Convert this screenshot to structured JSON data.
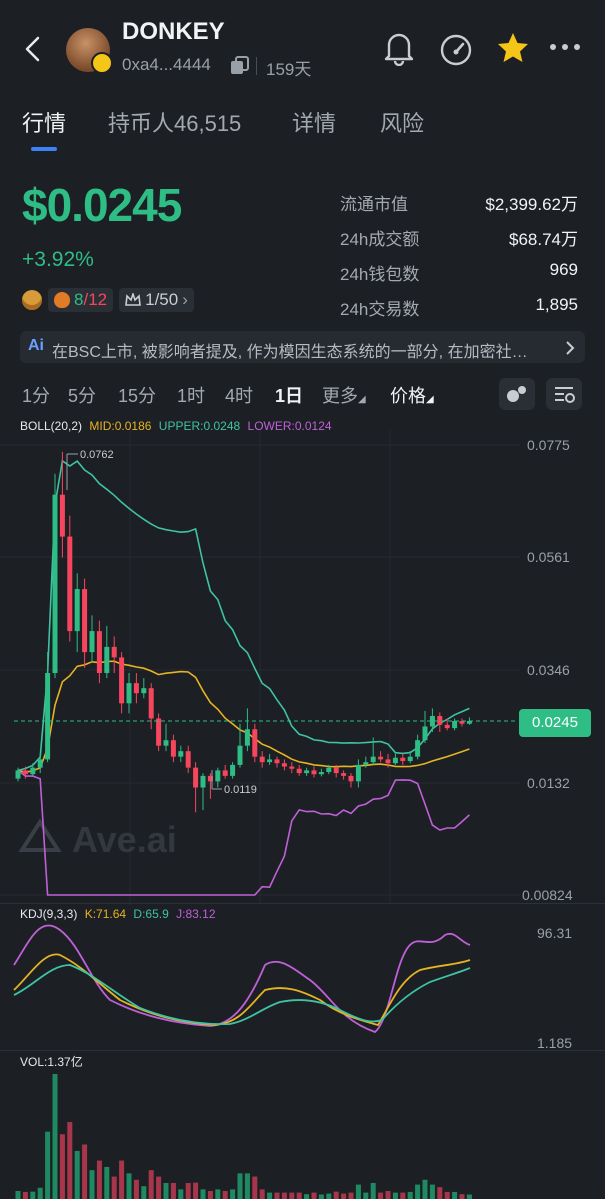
{
  "header": {
    "title": "DONKEY",
    "address": "0xa4...4444",
    "age": "159天"
  },
  "tabs": [
    {
      "label": "行情"
    },
    {
      "label": "持币人46,515"
    },
    {
      "label": "详情"
    },
    {
      "label": "风险"
    }
  ],
  "price": {
    "value": "$0.0245",
    "change": "+3.92%"
  },
  "badges": {
    "holders_ratio_a": "8",
    "holders_ratio_b": "/12",
    "rank": "1/50"
  },
  "stats": [
    {
      "label": "流通市值",
      "value": "$2,399.62万"
    },
    {
      "label": "24h成交额",
      "value": "$68.74万"
    },
    {
      "label": "24h钱包数",
      "value": "969"
    },
    {
      "label": "24h交易数",
      "value": "1,895"
    }
  ],
  "ai_summary": {
    "icon": "Ai",
    "text": "在BSC上市, 被影响者提及, 作为模因生态系统的一部分, 在加密社…"
  },
  "timeframes": [
    "1分",
    "5分",
    "15分",
    "1时",
    "4时",
    "1日",
    "更多",
    "价格"
  ],
  "active_timeframe": "1日",
  "boll": {
    "label": "BOLL(20,2)",
    "mid": "MID:0.0186",
    "upper": "UPPER:0.0248",
    "lower": "LOWER:0.0124"
  },
  "price_axis": [
    "0.0775",
    "0.0561",
    "0.0346",
    "0.0245",
    "0.0132",
    "0.00824"
  ],
  "annotations": {
    "high": "0.0762",
    "low": "0.0119"
  },
  "watermark": "Ave.ai",
  "kdj": {
    "label": "KDJ(9,3,3)",
    "k": "K:71.64",
    "d": "D:65.9",
    "j": "J:83.12",
    "axis_top": "96.31",
    "axis_bottom": "1.185"
  },
  "vol": {
    "label": "VOL:1.37亿"
  },
  "colors": {
    "up": "#2ebd85",
    "down": "#f6465d",
    "mid": "#e6b422",
    "upper": "#3fc3a2",
    "lower": "#c060d8",
    "accent": "#3b82f6",
    "star": "#f5c518"
  },
  "chart_data": {
    "type": "candlestick",
    "interval": "1日",
    "current_price": 0.0245,
    "y_axis_ticks": [
      0.0775,
      0.0561,
      0.0346,
      0.0132,
      0.00824
    ],
    "high_marker": 0.0762,
    "low_marker": 0.0119,
    "candles": [
      {
        "o": 0.014,
        "c": 0.0155,
        "h": 0.016,
        "l": 0.0135
      },
      {
        "o": 0.0155,
        "c": 0.0148,
        "h": 0.0162,
        "l": 0.014
      },
      {
        "o": 0.0148,
        "c": 0.016,
        "h": 0.0168,
        "l": 0.0145
      },
      {
        "o": 0.016,
        "c": 0.0175,
        "h": 0.0185,
        "l": 0.015
      },
      {
        "o": 0.0175,
        "c": 0.034,
        "h": 0.038,
        "l": 0.017
      },
      {
        "o": 0.034,
        "c": 0.068,
        "h": 0.072,
        "l": 0.033
      },
      {
        "o": 0.068,
        "c": 0.06,
        "h": 0.0762,
        "l": 0.056
      },
      {
        "o": 0.06,
        "c": 0.042,
        "h": 0.064,
        "l": 0.04
      },
      {
        "o": 0.042,
        "c": 0.05,
        "h": 0.053,
        "l": 0.038
      },
      {
        "o": 0.05,
        "c": 0.038,
        "h": 0.052,
        "l": 0.035
      },
      {
        "o": 0.038,
        "c": 0.042,
        "h": 0.045,
        "l": 0.036
      },
      {
        "o": 0.042,
        "c": 0.034,
        "h": 0.044,
        "l": 0.032
      },
      {
        "o": 0.034,
        "c": 0.039,
        "h": 0.043,
        "l": 0.033
      },
      {
        "o": 0.039,
        "c": 0.037,
        "h": 0.041,
        "l": 0.034
      },
      {
        "o": 0.037,
        "c": 0.028,
        "h": 0.038,
        "l": 0.026
      },
      {
        "o": 0.028,
        "c": 0.032,
        "h": 0.034,
        "l": 0.026
      },
      {
        "o": 0.032,
        "c": 0.03,
        "h": 0.034,
        "l": 0.028
      },
      {
        "o": 0.03,
        "c": 0.031,
        "h": 0.033,
        "l": 0.029
      },
      {
        "o": 0.031,
        "c": 0.025,
        "h": 0.032,
        "l": 0.023
      },
      {
        "o": 0.025,
        "c": 0.02,
        "h": 0.026,
        "l": 0.019
      },
      {
        "o": 0.02,
        "c": 0.021,
        "h": 0.024,
        "l": 0.019
      },
      {
        "o": 0.021,
        "c": 0.018,
        "h": 0.022,
        "l": 0.017
      },
      {
        "o": 0.018,
        "c": 0.019,
        "h": 0.02,
        "l": 0.017
      },
      {
        "o": 0.019,
        "c": 0.016,
        "h": 0.02,
        "l": 0.015
      },
      {
        "o": 0.016,
        "c": 0.013,
        "h": 0.017,
        "l": 0.0119
      },
      {
        "o": 0.013,
        "c": 0.0145,
        "h": 0.015,
        "l": 0.012
      },
      {
        "o": 0.0145,
        "c": 0.0135,
        "h": 0.015,
        "l": 0.0125
      },
      {
        "o": 0.0135,
        "c": 0.0155,
        "h": 0.016,
        "l": 0.013
      },
      {
        "o": 0.0155,
        "c": 0.0145,
        "h": 0.0165,
        "l": 0.014
      },
      {
        "o": 0.0145,
        "c": 0.0165,
        "h": 0.017,
        "l": 0.014
      },
      {
        "o": 0.0165,
        "c": 0.02,
        "h": 0.024,
        "l": 0.016
      },
      {
        "o": 0.02,
        "c": 0.023,
        "h": 0.027,
        "l": 0.019
      },
      {
        "o": 0.023,
        "c": 0.018,
        "h": 0.024,
        "l": 0.017
      },
      {
        "o": 0.018,
        "c": 0.017,
        "h": 0.019,
        "l": 0.016
      },
      {
        "o": 0.017,
        "c": 0.0175,
        "h": 0.0185,
        "l": 0.0165
      },
      {
        "o": 0.0175,
        "c": 0.0168,
        "h": 0.018,
        "l": 0.016
      },
      {
        "o": 0.0168,
        "c": 0.0162,
        "h": 0.0175,
        "l": 0.0155
      },
      {
        "o": 0.0162,
        "c": 0.0158,
        "h": 0.017,
        "l": 0.015
      },
      {
        "o": 0.0158,
        "c": 0.015,
        "h": 0.0165,
        "l": 0.0145
      },
      {
        "o": 0.015,
        "c": 0.0155,
        "h": 0.016,
        "l": 0.0145
      },
      {
        "o": 0.0155,
        "c": 0.0148,
        "h": 0.0162,
        "l": 0.0142
      },
      {
        "o": 0.0148,
        "c": 0.0152,
        "h": 0.0158,
        "l": 0.0144
      },
      {
        "o": 0.0152,
        "c": 0.016,
        "h": 0.0165,
        "l": 0.0148
      },
      {
        "o": 0.016,
        "c": 0.015,
        "h": 0.0165,
        "l": 0.0142
      },
      {
        "o": 0.015,
        "c": 0.0145,
        "h": 0.0155,
        "l": 0.0138
      },
      {
        "o": 0.0145,
        "c": 0.0135,
        "h": 0.015,
        "l": 0.013
      },
      {
        "o": 0.0135,
        "c": 0.0165,
        "h": 0.0175,
        "l": 0.013
      },
      {
        "o": 0.0165,
        "c": 0.017,
        "h": 0.018,
        "l": 0.016
      },
      {
        "o": 0.017,
        "c": 0.018,
        "h": 0.0215,
        "l": 0.0165
      },
      {
        "o": 0.018,
        "c": 0.0175,
        "h": 0.019,
        "l": 0.017
      },
      {
        "o": 0.0175,
        "c": 0.0168,
        "h": 0.0185,
        "l": 0.016
      },
      {
        "o": 0.0168,
        "c": 0.0178,
        "h": 0.0185,
        "l": 0.0165
      },
      {
        "o": 0.0178,
        "c": 0.0172,
        "h": 0.0185,
        "l": 0.0165
      },
      {
        "o": 0.0172,
        "c": 0.018,
        "h": 0.019,
        "l": 0.0168
      },
      {
        "o": 0.018,
        "c": 0.021,
        "h": 0.022,
        "l": 0.0175
      },
      {
        "o": 0.021,
        "c": 0.0235,
        "h": 0.0265,
        "l": 0.0205
      },
      {
        "o": 0.0235,
        "c": 0.0255,
        "h": 0.027,
        "l": 0.0225
      },
      {
        "o": 0.0255,
        "c": 0.0238,
        "h": 0.0262,
        "l": 0.0225
      },
      {
        "o": 0.0238,
        "c": 0.0232,
        "h": 0.025,
        "l": 0.0228
      },
      {
        "o": 0.0232,
        "c": 0.0245,
        "h": 0.025,
        "l": 0.0228
      },
      {
        "o": 0.0245,
        "c": 0.024,
        "h": 0.025,
        "l": 0.0235
      },
      {
        "o": 0.024,
        "c": 0.0245,
        "h": 0.0252,
        "l": 0.0238
      }
    ]
  }
}
